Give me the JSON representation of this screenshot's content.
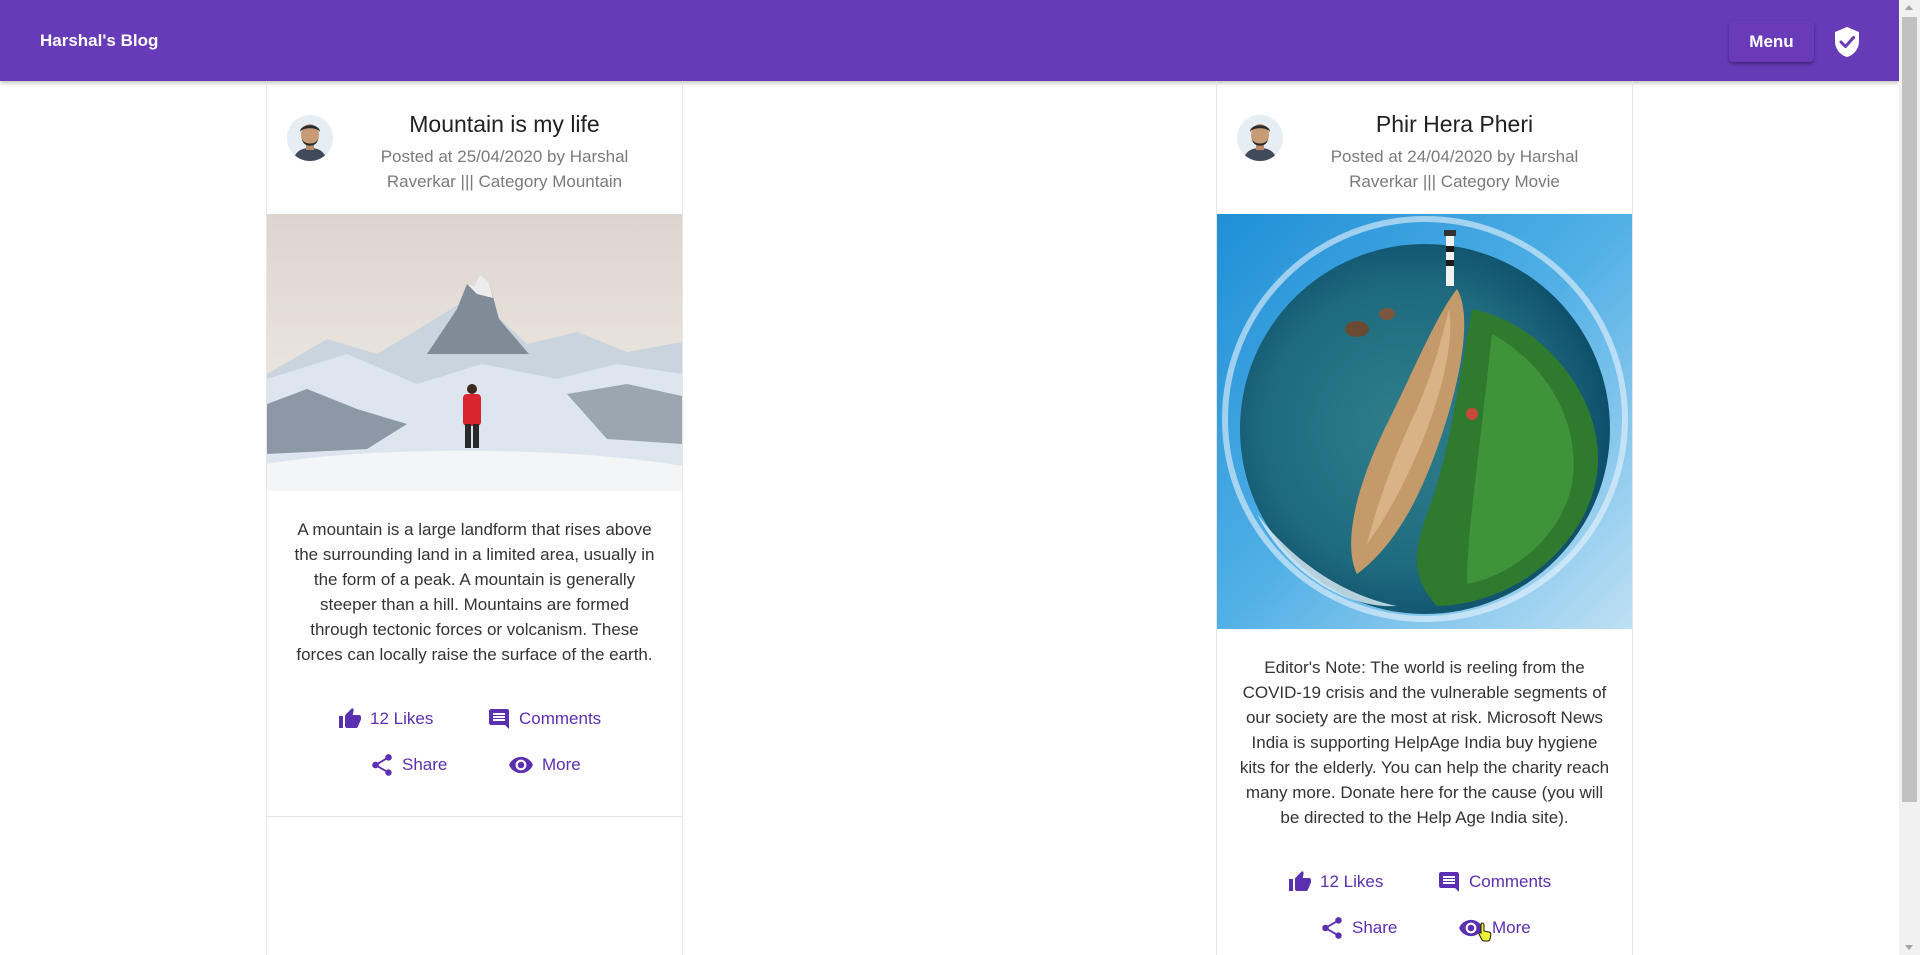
{
  "toolbar": {
    "title": "Harshal's Blog",
    "menu_label": "Menu",
    "shield_icon": "verified-shield-icon"
  },
  "colors": {
    "primary": "#673ab7",
    "action": "#5a2fb0"
  },
  "posts": [
    {
      "title": "Mountain is my life",
      "meta": "Posted at 25/04/2020 by Harshal Raverkar ||| Category Mountain",
      "body": "A mountain is a large landform that rises above the surrounding land in a limited area, usually in the form of a peak. A mountain is generally steeper than a hill. Mountains are formed through tectonic forces or volcanism. These forces can locally raise the surface of the earth.",
      "likes": "12 Likes",
      "comments": "Comments",
      "share": "Share",
      "more": "More"
    },
    {
      "title": "Phir Hera Pheri",
      "meta": "Posted at 24/04/2020 by Harshal Raverkar ||| Category Movie",
      "body": "Editor's Note: The world is reeling from the COVID-19 crisis and the vulnerable segments of our society are the most at risk. Microsoft News India is supporting HelpAge India buy hygiene kits for the elderly. You can help the charity reach many more. Donate here for the cause (you will be directed to the Help Age India site).",
      "likes": "12 Likes",
      "comments": "Comments",
      "share": "Share",
      "more": "More"
    }
  ]
}
